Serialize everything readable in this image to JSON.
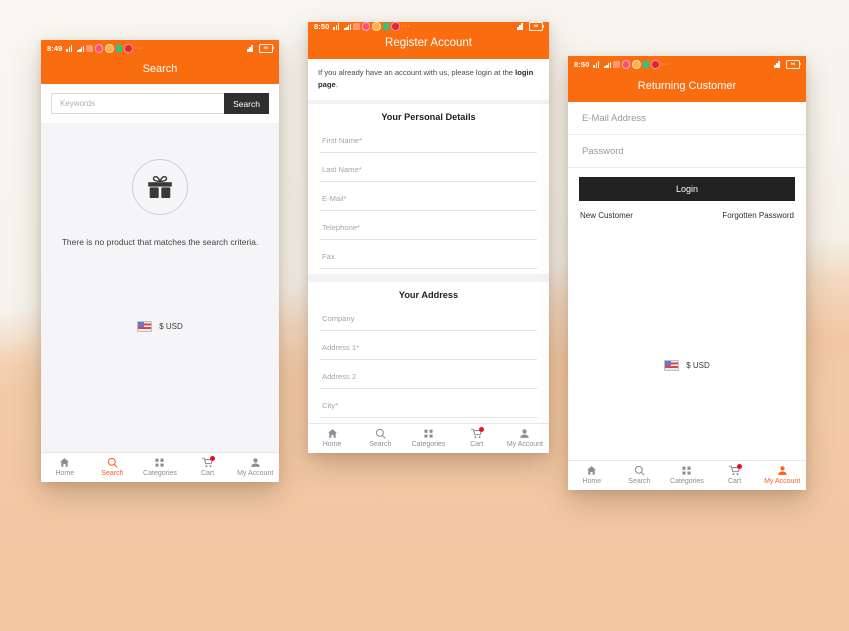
{
  "theme": {
    "accent": "#f96d10",
    "accent_text": "#f9621a",
    "dark_button": "#222222",
    "badge_red": "#e8121f",
    "bg_top": "#f6f4ee",
    "bg_bottom": "#f2c8a4"
  },
  "tabs": {
    "home": "Home",
    "search": "Search",
    "categories": "Categories",
    "cart": "Cart",
    "account": "My Account"
  },
  "currency": {
    "label": "$ USD",
    "flag": "us-flag-icon"
  },
  "phone_search": {
    "status": {
      "time": "8:49",
      "battery": "96"
    },
    "title": "Search",
    "search_input_placeholder": "Keywords",
    "search_button": "Search",
    "empty_icon": "gift-icon",
    "empty_message": "There is no product that matches the search criteria.",
    "active_tab": "search"
  },
  "phone_register": {
    "status": {
      "time": "8:50",
      "battery": "96"
    },
    "title": "Register Account",
    "notice_prefix": "If you already have an account with us, please login at the ",
    "notice_link": "login page",
    "notice_suffix": ".",
    "section_personal": "Your Personal Details",
    "personal_fields": [
      "First Name*",
      "Last Name*",
      "E-Mail*",
      "Telephone*",
      "Fax"
    ],
    "section_address": "Your Address",
    "address_fields": [
      "Company",
      "Address 1*",
      "Address 2",
      "City*"
    ],
    "active_tab": "none"
  },
  "phone_login": {
    "status": {
      "time": "8:50",
      "battery": "96"
    },
    "title": "Returning Customer",
    "email_placeholder": "E-Mail Address",
    "password_placeholder": "Password",
    "login_button": "Login",
    "new_customer_link": "New Customer",
    "forgotten_password_link": "Forgotten Password",
    "active_tab": "account"
  }
}
